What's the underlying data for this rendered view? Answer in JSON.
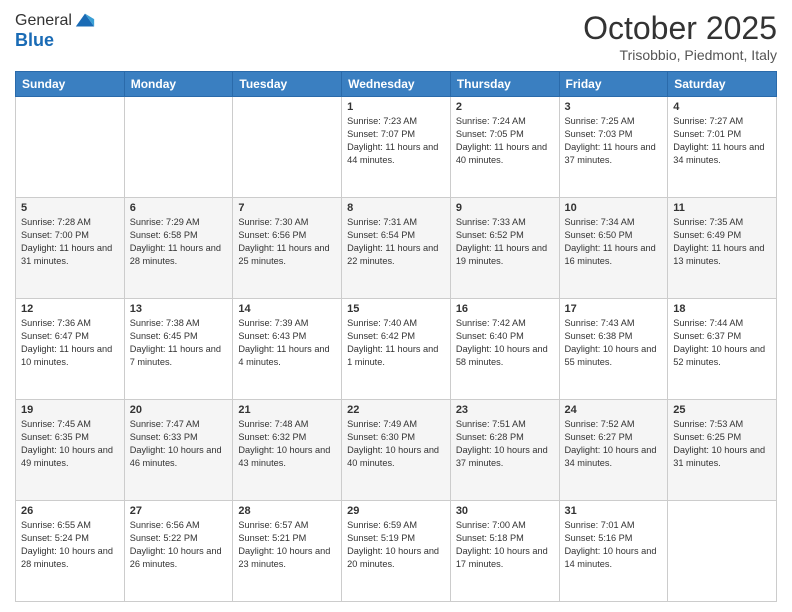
{
  "logo": {
    "line1": "General",
    "line2": "Blue"
  },
  "title": "October 2025",
  "location": "Trisobbio, Piedmont, Italy",
  "days_of_week": [
    "Sunday",
    "Monday",
    "Tuesday",
    "Wednesday",
    "Thursday",
    "Friday",
    "Saturday"
  ],
  "weeks": [
    [
      {
        "day": "",
        "text": ""
      },
      {
        "day": "",
        "text": ""
      },
      {
        "day": "",
        "text": ""
      },
      {
        "day": "1",
        "text": "Sunrise: 7:23 AM\nSunset: 7:07 PM\nDaylight: 11 hours and 44 minutes."
      },
      {
        "day": "2",
        "text": "Sunrise: 7:24 AM\nSunset: 7:05 PM\nDaylight: 11 hours and 40 minutes."
      },
      {
        "day": "3",
        "text": "Sunrise: 7:25 AM\nSunset: 7:03 PM\nDaylight: 11 hours and 37 minutes."
      },
      {
        "day": "4",
        "text": "Sunrise: 7:27 AM\nSunset: 7:01 PM\nDaylight: 11 hours and 34 minutes."
      }
    ],
    [
      {
        "day": "5",
        "text": "Sunrise: 7:28 AM\nSunset: 7:00 PM\nDaylight: 11 hours and 31 minutes."
      },
      {
        "day": "6",
        "text": "Sunrise: 7:29 AM\nSunset: 6:58 PM\nDaylight: 11 hours and 28 minutes."
      },
      {
        "day": "7",
        "text": "Sunrise: 7:30 AM\nSunset: 6:56 PM\nDaylight: 11 hours and 25 minutes."
      },
      {
        "day": "8",
        "text": "Sunrise: 7:31 AM\nSunset: 6:54 PM\nDaylight: 11 hours and 22 minutes."
      },
      {
        "day": "9",
        "text": "Sunrise: 7:33 AM\nSunset: 6:52 PM\nDaylight: 11 hours and 19 minutes."
      },
      {
        "day": "10",
        "text": "Sunrise: 7:34 AM\nSunset: 6:50 PM\nDaylight: 11 hours and 16 minutes."
      },
      {
        "day": "11",
        "text": "Sunrise: 7:35 AM\nSunset: 6:49 PM\nDaylight: 11 hours and 13 minutes."
      }
    ],
    [
      {
        "day": "12",
        "text": "Sunrise: 7:36 AM\nSunset: 6:47 PM\nDaylight: 11 hours and 10 minutes."
      },
      {
        "day": "13",
        "text": "Sunrise: 7:38 AM\nSunset: 6:45 PM\nDaylight: 11 hours and 7 minutes."
      },
      {
        "day": "14",
        "text": "Sunrise: 7:39 AM\nSunset: 6:43 PM\nDaylight: 11 hours and 4 minutes."
      },
      {
        "day": "15",
        "text": "Sunrise: 7:40 AM\nSunset: 6:42 PM\nDaylight: 11 hours and 1 minute."
      },
      {
        "day": "16",
        "text": "Sunrise: 7:42 AM\nSunset: 6:40 PM\nDaylight: 10 hours and 58 minutes."
      },
      {
        "day": "17",
        "text": "Sunrise: 7:43 AM\nSunset: 6:38 PM\nDaylight: 10 hours and 55 minutes."
      },
      {
        "day": "18",
        "text": "Sunrise: 7:44 AM\nSunset: 6:37 PM\nDaylight: 10 hours and 52 minutes."
      }
    ],
    [
      {
        "day": "19",
        "text": "Sunrise: 7:45 AM\nSunset: 6:35 PM\nDaylight: 10 hours and 49 minutes."
      },
      {
        "day": "20",
        "text": "Sunrise: 7:47 AM\nSunset: 6:33 PM\nDaylight: 10 hours and 46 minutes."
      },
      {
        "day": "21",
        "text": "Sunrise: 7:48 AM\nSunset: 6:32 PM\nDaylight: 10 hours and 43 minutes."
      },
      {
        "day": "22",
        "text": "Sunrise: 7:49 AM\nSunset: 6:30 PM\nDaylight: 10 hours and 40 minutes."
      },
      {
        "day": "23",
        "text": "Sunrise: 7:51 AM\nSunset: 6:28 PM\nDaylight: 10 hours and 37 minutes."
      },
      {
        "day": "24",
        "text": "Sunrise: 7:52 AM\nSunset: 6:27 PM\nDaylight: 10 hours and 34 minutes."
      },
      {
        "day": "25",
        "text": "Sunrise: 7:53 AM\nSunset: 6:25 PM\nDaylight: 10 hours and 31 minutes."
      }
    ],
    [
      {
        "day": "26",
        "text": "Sunrise: 6:55 AM\nSunset: 5:24 PM\nDaylight: 10 hours and 28 minutes."
      },
      {
        "day": "27",
        "text": "Sunrise: 6:56 AM\nSunset: 5:22 PM\nDaylight: 10 hours and 26 minutes."
      },
      {
        "day": "28",
        "text": "Sunrise: 6:57 AM\nSunset: 5:21 PM\nDaylight: 10 hours and 23 minutes."
      },
      {
        "day": "29",
        "text": "Sunrise: 6:59 AM\nSunset: 5:19 PM\nDaylight: 10 hours and 20 minutes."
      },
      {
        "day": "30",
        "text": "Sunrise: 7:00 AM\nSunset: 5:18 PM\nDaylight: 10 hours and 17 minutes."
      },
      {
        "day": "31",
        "text": "Sunrise: 7:01 AM\nSunset: 5:16 PM\nDaylight: 10 hours and 14 minutes."
      },
      {
        "day": "",
        "text": ""
      }
    ]
  ]
}
